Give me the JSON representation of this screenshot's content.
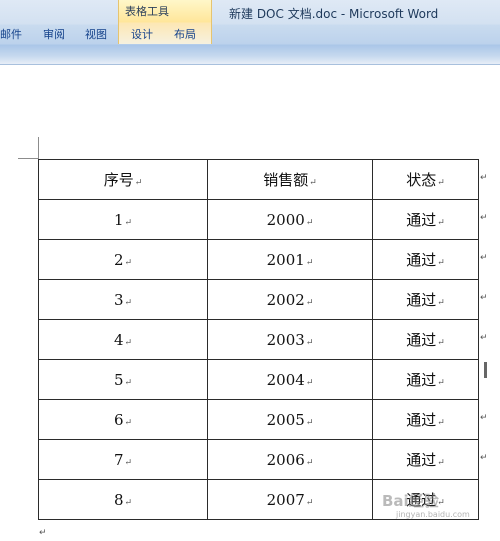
{
  "window": {
    "title": "新建 DOC 文档.doc - Microsoft Word",
    "context_tab_group": "表格工具"
  },
  "ribbon": {
    "tabs": [
      {
        "label": "邮件"
      },
      {
        "label": "审阅"
      },
      {
        "label": "视图"
      },
      {
        "label": "设计"
      },
      {
        "label": "布局"
      }
    ]
  },
  "table": {
    "headers": [
      "序号",
      "销售额",
      "状态"
    ],
    "rows": [
      [
        "1",
        "2000",
        "通过"
      ],
      [
        "2",
        "2001",
        "通过"
      ],
      [
        "3",
        "2002",
        "通过"
      ],
      [
        "4",
        "2003",
        "通过"
      ],
      [
        "5",
        "2004",
        "通过"
      ],
      [
        "6",
        "2005",
        "通过"
      ],
      [
        "7",
        "2006",
        "通过"
      ],
      [
        "8",
        "2007",
        "通过"
      ]
    ]
  },
  "marks": {
    "cell_end": "↵",
    "paragraph_end": "↵"
  },
  "watermark": {
    "text": "Bai经验",
    "sub": "jingyan.baidu.com"
  }
}
